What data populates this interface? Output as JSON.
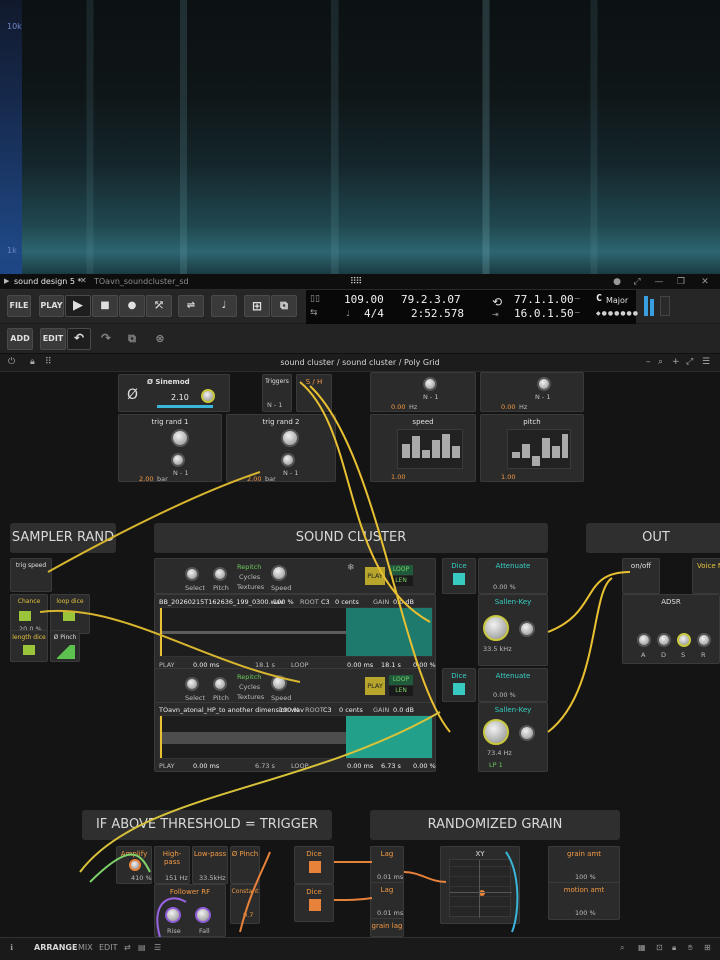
{
  "spectrogram": {
    "freq_labels": [
      "10k",
      "1k"
    ]
  },
  "tabs": [
    {
      "label": "sound design 5 *",
      "active": true
    },
    {
      "label": "TOavn_soundcluster_sd",
      "active": false
    }
  ],
  "transport": {
    "file_label": "FILE",
    "play_label": "PLAY",
    "tempo": "109.00",
    "time_signature": "4/4",
    "position_beats": "79.2.3.07",
    "position_time": "2:52.578",
    "loop_start": "77.1.1.00",
    "loop_length": "16.0.1.50",
    "key_root": "C",
    "key_scale": "Major"
  },
  "toolbar2": {
    "add_label": "ADD",
    "edit_label": "EDIT"
  },
  "panel": {
    "title": "sound cluster / sound cluster / Poly Grid"
  },
  "groups": {
    "sampler_rand": "SAMPLER RAND",
    "sound_cluster": "SOUND CLUSTER",
    "out": "OUT",
    "if_above": "IF ABOVE THRESHOLD = TRIGGER",
    "randomized_grain": "RANDOMIZED GRAIN"
  },
  "top_modules": {
    "sinemod_title": "Ø Sinemod",
    "sinemod_value": "2.10",
    "triggers_title": "Triggers",
    "sh_title": "S / H",
    "n_label": "N - 1",
    "trig_rand1": "trig rand 1",
    "trig_rand2": "trig rand 2",
    "speed_title": "speed",
    "pitch_title": "pitch",
    "val_200": "2.00",
    "val_100": "1.00",
    "val_000": "0.00",
    "unit_bar": "bar",
    "unit_hz": "Hz",
    "val_0": "0"
  },
  "sampler_rand_mods": {
    "trig_speed": "trig speed",
    "chance": "Chance",
    "chance_value": "20.0 %",
    "loop_dice": "loop dice",
    "length_dice": "length dice",
    "pinch": "Ø Pinch"
  },
  "sampler1": {
    "select": "Select",
    "pitch": "Pitch",
    "speed": "Speed",
    "repitch": "Repitch",
    "cycles": "Cycles",
    "textures": "Textures",
    "play": "PLAY",
    "loop": "LOOP",
    "len": "LEN",
    "file": "BB_20260215T162636_199_0300.wav",
    "percent": "100 %",
    "root_label": "ROOT",
    "root": "C3",
    "cents": "0 cents",
    "gain_label": "GAIN",
    "gain": "0.0 dB",
    "play_footer": "PLAY",
    "start": "0.00 ms",
    "length_dim": "18.1 s",
    "loop_footer": "LOOP",
    "loop_start": "0.00 ms",
    "loop_len": "18.1 s",
    "loop_pct": "0.00 %"
  },
  "sampler2": {
    "file": "TOavn_atonal_HP_to another dimension.wav",
    "percent": "100 %",
    "root_label": "ROOT",
    "root": "C3",
    "cents": "0 cents",
    "gain_label": "GAIN",
    "gain": "0.0 dB",
    "start": "0.00 ms",
    "length_dim": "6.73 s",
    "loop_start": "0.00 ms",
    "loop_len": "6.73 s",
    "loop_pct": "0.00 %"
  },
  "filters": {
    "dice": "Dice",
    "attenuate": "Attenuate",
    "pct": "0.00 %",
    "sallen_key": "Sallen-Key",
    "freq1": "33.5 kHz",
    "freq2": "73.4 Hz",
    "mode": "LP 1"
  },
  "out_mods": {
    "on_off": "on/off",
    "voice_mix": "Voice M",
    "adsr": "ADSR",
    "a": "A",
    "d": "D",
    "s": "S",
    "r": "R"
  },
  "threshold_mods": {
    "amplify": "Amplify",
    "amplify_val": "410 %",
    "high_pass": "High-pass",
    "high_pass_val": "151 Hz",
    "low_pass": "Low-pass",
    "low_pass_val": "33.5kHz",
    "pinch": "Ø Pinch",
    "follower": "Follower RF",
    "constant": "Constant",
    "constant_val": "0.7",
    "rise": "Rise",
    "fall": "Fall",
    "dice1": "Dice",
    "dice2": "Dice"
  },
  "grain_mods": {
    "lag1": "Lag",
    "lag1_val": "0.01 ms",
    "lag2": "Lag",
    "lag2_val": "0.01 ms",
    "grain_lag": "grain lag",
    "xy": "XY",
    "grain_amt": "grain amt",
    "grain_amt_val": "100 %",
    "motion_amt": "motion amt",
    "motion_amt_val": "100 %"
  },
  "bottom": {
    "arrange": "ARRANGE",
    "mix": "MIX",
    "edit": "EDIT"
  }
}
